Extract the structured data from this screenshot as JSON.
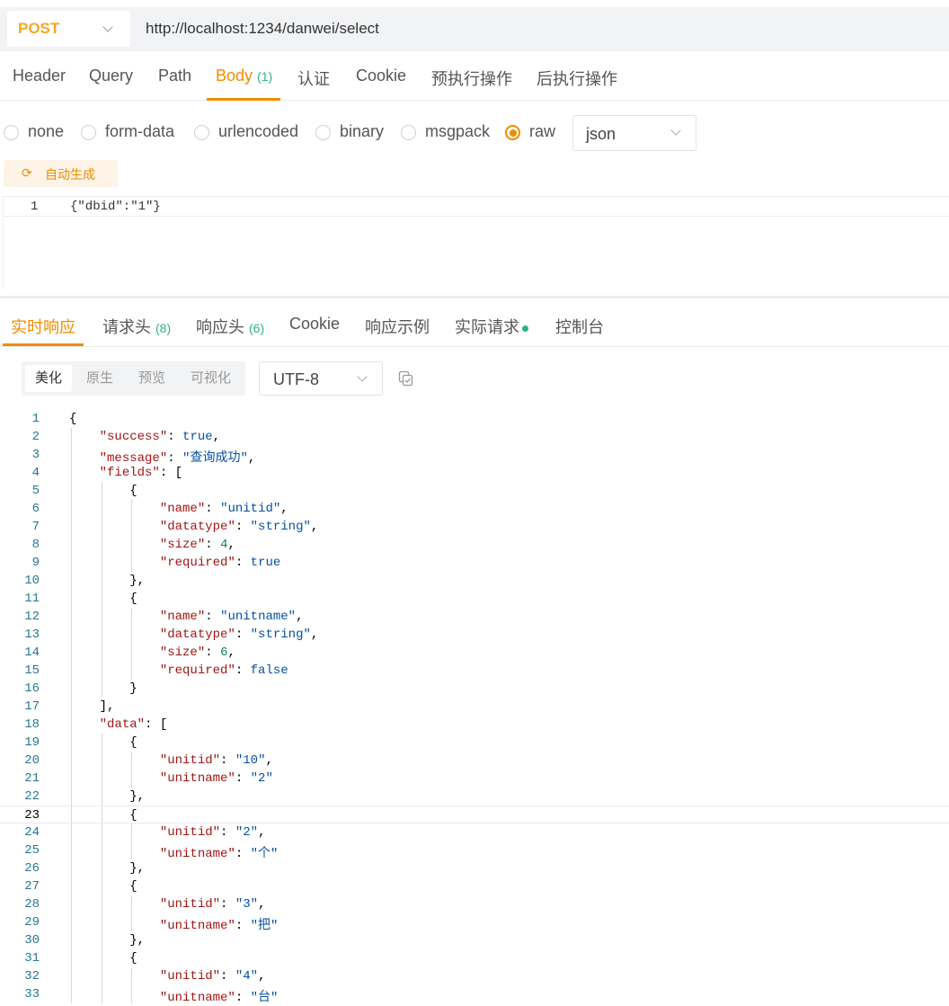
{
  "request": {
    "method": "POST",
    "url": "http://localhost:1234/danwei/select"
  },
  "request_tabs": [
    {
      "label": "Header",
      "count": ""
    },
    {
      "label": "Query",
      "count": ""
    },
    {
      "label": "Path",
      "count": ""
    },
    {
      "label": "Body",
      "count": "(1)"
    },
    {
      "label": "认证",
      "count": ""
    },
    {
      "label": "Cookie",
      "count": ""
    },
    {
      "label": "预执行操作",
      "count": ""
    },
    {
      "label": "后执行操作",
      "count": ""
    }
  ],
  "active_request_tab": "Body",
  "body_types": [
    "none",
    "form-data",
    "urlencoded",
    "binary",
    "msgpack",
    "raw"
  ],
  "selected_body_type": "raw",
  "raw_format": "json",
  "auto_generate_label": "自动生成",
  "request_body": {
    "line_number": "1",
    "code": "{\"dbid\":\"1\"}"
  },
  "response_tabs": [
    {
      "label": "实时响应",
      "count": ""
    },
    {
      "label": "请求头",
      "count": "(8)"
    },
    {
      "label": "响应头",
      "count": "(6)"
    },
    {
      "label": "Cookie",
      "count": ""
    },
    {
      "label": "响应示例",
      "count": ""
    },
    {
      "label": "实际请求",
      "count": ""
    },
    {
      "label": "控制台",
      "count": ""
    }
  ],
  "active_response_tab": "实时响应",
  "view_modes": [
    "美化",
    "原生",
    "预览",
    "可视化"
  ],
  "active_view_mode": "美化",
  "encoding": "UTF-8",
  "highlighted_line": 23,
  "response_lines": [
    [
      {
        "t": "p",
        "v": "{"
      }
    ],
    [
      {
        "t": "p",
        "v": "    "
      },
      {
        "t": "k",
        "v": "\"success\""
      },
      {
        "t": "p",
        "v": ": "
      },
      {
        "t": "b",
        "v": "true"
      },
      {
        "t": "p",
        "v": ","
      }
    ],
    [
      {
        "t": "p",
        "v": "    "
      },
      {
        "t": "k",
        "v": "\"message\""
      },
      {
        "t": "p",
        "v": ": "
      },
      {
        "t": "s",
        "v": "\"查询成功\""
      },
      {
        "t": "p",
        "v": ","
      }
    ],
    [
      {
        "t": "p",
        "v": "    "
      },
      {
        "t": "k",
        "v": "\"fields\""
      },
      {
        "t": "p",
        "v": ": ["
      }
    ],
    [
      {
        "t": "p",
        "v": "        {"
      }
    ],
    [
      {
        "t": "p",
        "v": "            "
      },
      {
        "t": "k",
        "v": "\"name\""
      },
      {
        "t": "p",
        "v": ": "
      },
      {
        "t": "s",
        "v": "\"unitid\""
      },
      {
        "t": "p",
        "v": ","
      }
    ],
    [
      {
        "t": "p",
        "v": "            "
      },
      {
        "t": "k",
        "v": "\"datatype\""
      },
      {
        "t": "p",
        "v": ": "
      },
      {
        "t": "s",
        "v": "\"string\""
      },
      {
        "t": "p",
        "v": ","
      }
    ],
    [
      {
        "t": "p",
        "v": "            "
      },
      {
        "t": "k",
        "v": "\"size\""
      },
      {
        "t": "p",
        "v": ": "
      },
      {
        "t": "n",
        "v": "4"
      },
      {
        "t": "p",
        "v": ","
      }
    ],
    [
      {
        "t": "p",
        "v": "            "
      },
      {
        "t": "k",
        "v": "\"required\""
      },
      {
        "t": "p",
        "v": ": "
      },
      {
        "t": "b",
        "v": "true"
      }
    ],
    [
      {
        "t": "p",
        "v": "        },"
      }
    ],
    [
      {
        "t": "p",
        "v": "        {"
      }
    ],
    [
      {
        "t": "p",
        "v": "            "
      },
      {
        "t": "k",
        "v": "\"name\""
      },
      {
        "t": "p",
        "v": ": "
      },
      {
        "t": "s",
        "v": "\"unitname\""
      },
      {
        "t": "p",
        "v": ","
      }
    ],
    [
      {
        "t": "p",
        "v": "            "
      },
      {
        "t": "k",
        "v": "\"datatype\""
      },
      {
        "t": "p",
        "v": ": "
      },
      {
        "t": "s",
        "v": "\"string\""
      },
      {
        "t": "p",
        "v": ","
      }
    ],
    [
      {
        "t": "p",
        "v": "            "
      },
      {
        "t": "k",
        "v": "\"size\""
      },
      {
        "t": "p",
        "v": ": "
      },
      {
        "t": "n",
        "v": "6"
      },
      {
        "t": "p",
        "v": ","
      }
    ],
    [
      {
        "t": "p",
        "v": "            "
      },
      {
        "t": "k",
        "v": "\"required\""
      },
      {
        "t": "p",
        "v": ": "
      },
      {
        "t": "b",
        "v": "false"
      }
    ],
    [
      {
        "t": "p",
        "v": "        }"
      }
    ],
    [
      {
        "t": "p",
        "v": "    ],"
      }
    ],
    [
      {
        "t": "p",
        "v": "    "
      },
      {
        "t": "k",
        "v": "\"data\""
      },
      {
        "t": "p",
        "v": ": ["
      }
    ],
    [
      {
        "t": "p",
        "v": "        {"
      }
    ],
    [
      {
        "t": "p",
        "v": "            "
      },
      {
        "t": "k",
        "v": "\"unitid\""
      },
      {
        "t": "p",
        "v": ": "
      },
      {
        "t": "s",
        "v": "\"10\""
      },
      {
        "t": "p",
        "v": ","
      }
    ],
    [
      {
        "t": "p",
        "v": "            "
      },
      {
        "t": "k",
        "v": "\"unitname\""
      },
      {
        "t": "p",
        "v": ": "
      },
      {
        "t": "s",
        "v": "\"2\""
      }
    ],
    [
      {
        "t": "p",
        "v": "        },"
      }
    ],
    [
      {
        "t": "p",
        "v": "        {"
      }
    ],
    [
      {
        "t": "p",
        "v": "            "
      },
      {
        "t": "k",
        "v": "\"unitid\""
      },
      {
        "t": "p",
        "v": ": "
      },
      {
        "t": "s",
        "v": "\"2\""
      },
      {
        "t": "p",
        "v": ","
      }
    ],
    [
      {
        "t": "p",
        "v": "            "
      },
      {
        "t": "k",
        "v": "\"unitname\""
      },
      {
        "t": "p",
        "v": ": "
      },
      {
        "t": "s",
        "v": "\"个\""
      }
    ],
    [
      {
        "t": "p",
        "v": "        },"
      }
    ],
    [
      {
        "t": "p",
        "v": "        {"
      }
    ],
    [
      {
        "t": "p",
        "v": "            "
      },
      {
        "t": "k",
        "v": "\"unitid\""
      },
      {
        "t": "p",
        "v": ": "
      },
      {
        "t": "s",
        "v": "\"3\""
      },
      {
        "t": "p",
        "v": ","
      }
    ],
    [
      {
        "t": "p",
        "v": "            "
      },
      {
        "t": "k",
        "v": "\"unitname\""
      },
      {
        "t": "p",
        "v": ": "
      },
      {
        "t": "s",
        "v": "\"把\""
      }
    ],
    [
      {
        "t": "p",
        "v": "        },"
      }
    ],
    [
      {
        "t": "p",
        "v": "        {"
      }
    ],
    [
      {
        "t": "p",
        "v": "            "
      },
      {
        "t": "k",
        "v": "\"unitid\""
      },
      {
        "t": "p",
        "v": ": "
      },
      {
        "t": "s",
        "v": "\"4\""
      },
      {
        "t": "p",
        "v": ","
      }
    ],
    [
      {
        "t": "p",
        "v": "            "
      },
      {
        "t": "k",
        "v": "\"unitname\""
      },
      {
        "t": "p",
        "v": ": "
      },
      {
        "t": "s",
        "v": "\"台\""
      }
    ]
  ],
  "colors": {
    "accent": "#f08c00",
    "method": "#f5a623",
    "count_green": "#2bb18a",
    "json_key": "#a31515",
    "json_string": "#0451a5",
    "json_number": "#098658",
    "line_number": "#237893"
  },
  "icons": {
    "method_dropdown": "chevron-down-icon",
    "format_dropdown": "chevron-down-icon",
    "auto_generate": "refresh-icon",
    "copy": "copy-icon",
    "status_dot": "green-dot-icon"
  }
}
